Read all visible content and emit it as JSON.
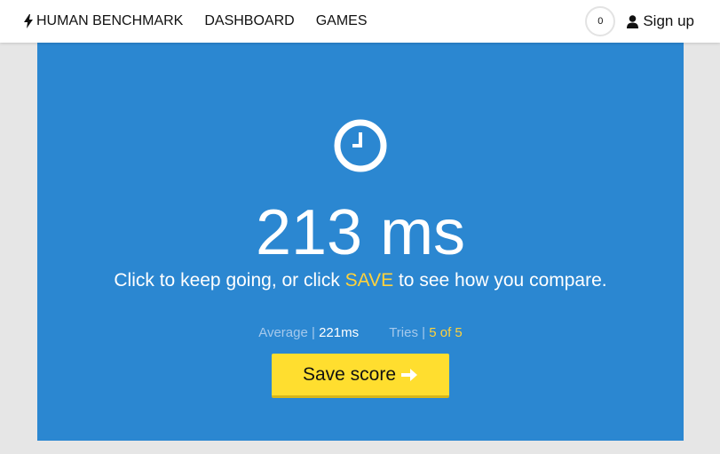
{
  "nav": {
    "brand": "HUMAN BENCHMARK",
    "brand_icon": "bolt-icon",
    "links": [
      "DASHBOARD",
      "GAMES"
    ],
    "notification_count": "0",
    "signup_label": "Sign up",
    "signup_icon": "user-icon"
  },
  "test": {
    "icon": "clock-icon",
    "result": "213 ms",
    "message_pre": "Click to keep going, or click ",
    "message_save": "SAVE",
    "message_post": " to see how you compare.",
    "average_label": "Average",
    "average_value": "221ms",
    "tries_label": "Tries",
    "tries_value": "5 of 5",
    "save_button": "Save score",
    "save_button_icon": "arrow-right-icon"
  },
  "colors": {
    "panel_bg": "#2b87d1",
    "accent_yellow": "#ffd23c",
    "button_bg": "#ffde2f"
  }
}
